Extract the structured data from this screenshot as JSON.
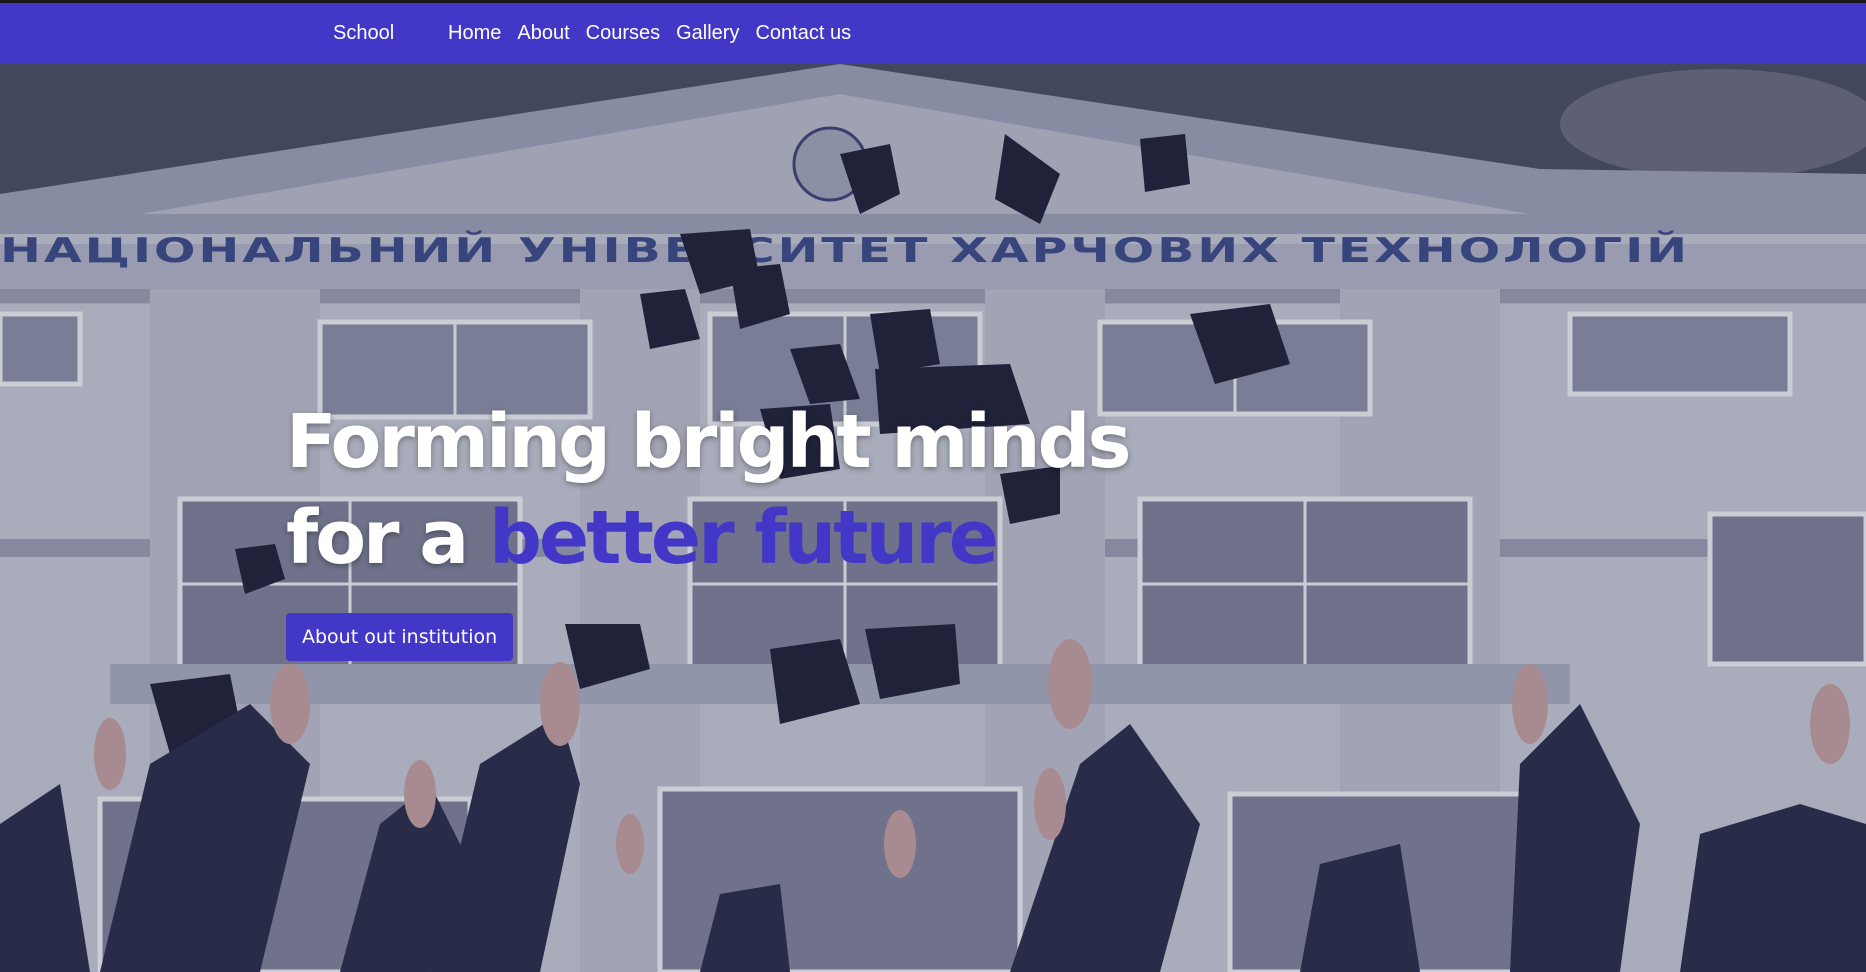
{
  "nav": {
    "brand": "School",
    "links": [
      "Home",
      "About",
      "Courses",
      "Gallery",
      "Contact us"
    ]
  },
  "hero": {
    "line1": "Forming bright minds",
    "line2_prefix": "for a ",
    "line2_accent": "better future",
    "button_label": "About out institution",
    "building_inscription": "НАЦІОНАЛЬНИЙ УНІВЕРСИТЕТ ХАРЧОВИХ ТЕХНОЛОГІЙ"
  },
  "colors": {
    "accent": "#4237c7",
    "text_light": "#ffffff"
  }
}
